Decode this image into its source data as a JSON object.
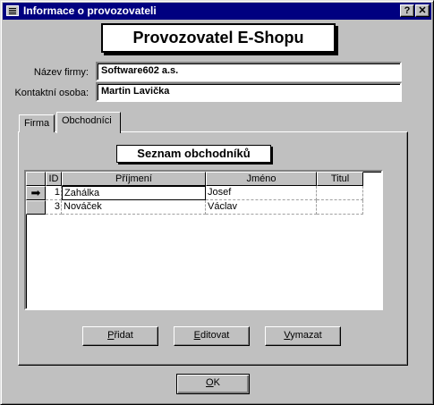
{
  "window": {
    "title": "Informace o provozovateli",
    "help_label": "?",
    "close_label": "✕"
  },
  "banner": "Provozovatel E-Shopu",
  "form": {
    "company_label": "Název firmy:",
    "company_value": "Software602 a.s.",
    "contact_label": "Kontaktní osoba:",
    "contact_value": "Martin Lavička"
  },
  "tabs": [
    {
      "label": "Firma",
      "active": false
    },
    {
      "label": "Obchodníci",
      "active": true
    }
  ],
  "list_title": "Seznam obchodníků",
  "table": {
    "columns": [
      "ID",
      "Příjmení",
      "Jméno",
      "Titul"
    ],
    "rows": [
      {
        "id": "1",
        "surname": "Zahálka",
        "name": "Josef",
        "title": "",
        "current": true
      },
      {
        "id": "3",
        "surname": "Nováček",
        "name": "Václav",
        "title": "",
        "current": false
      }
    ]
  },
  "buttons": {
    "add": {
      "mnemonic": "P",
      "rest": "řidat"
    },
    "edit": {
      "mnemonic": "E",
      "rest": "ditovat"
    },
    "delete": {
      "mnemonic": "V",
      "rest": "ymazat"
    },
    "ok": {
      "mnemonic": "O",
      "rest": "K"
    }
  }
}
